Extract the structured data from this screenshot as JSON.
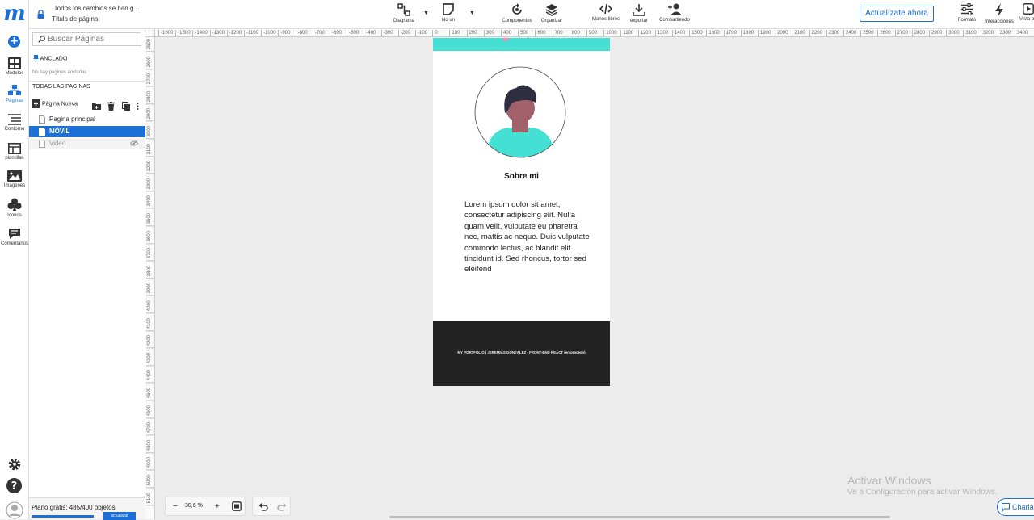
{
  "app": {
    "logo": "m"
  },
  "rail": {
    "items": [
      {
        "label": "Modelos",
        "icon": "templates-grid-icon"
      },
      {
        "label": "Páginas",
        "icon": "pages-icon"
      },
      {
        "label": "Contorno",
        "icon": "outline-icon"
      },
      {
        "label": "plantillas",
        "icon": "layout-icon"
      },
      {
        "label": "Imágenes",
        "icon": "image-icon"
      },
      {
        "label": "Iconos",
        "icon": "club-icon"
      },
      {
        "label": "Comentarios",
        "icon": "comment-icon"
      }
    ],
    "active_index": 1
  },
  "topbar": {
    "save_status": "¡Todos los cambios se han g...",
    "page_title": "Título de página",
    "tools": [
      {
        "label": "Diagrama"
      },
      {
        "label": "No un"
      },
      {
        "label": "Componentes"
      },
      {
        "label": "Organizar"
      },
      {
        "label": "Manos libres"
      },
      {
        "label": "exportar"
      },
      {
        "label": "Compartiendo"
      },
      {
        "label": "Formato"
      },
      {
        "label": "Interacciones"
      },
      {
        "label": "Vista p"
      }
    ],
    "upgrade_label": "Actualízate ahora"
  },
  "panel": {
    "search_placeholder": "Buscar Páginas",
    "pinned_header": "ANCLADO",
    "pinned_empty": "No hay páginas ancladas",
    "all_pages_header": "TODAS LAS PAGINAS",
    "new_page_label": "Página Nueva",
    "pages": [
      {
        "name": "Pagina principal",
        "state": "normal"
      },
      {
        "name": "MÓVIL",
        "state": "selected"
      },
      {
        "name": "Video",
        "state": "hidden"
      }
    ],
    "plan_text": "Plano gratis: 485/400 objetos",
    "plan_usage": 1.0,
    "plan_button": "actualizar"
  },
  "ruler": {
    "h_ticks": [
      "-1600",
      "-1500",
      "-1400",
      "-1300",
      "-1200",
      "-1100",
      "-1000",
      "-900",
      "-800",
      "-700",
      "-600",
      "-500",
      "-400",
      "-300",
      "-200",
      "-100",
      "0",
      "100",
      "200",
      "300",
      "400",
      "500",
      "600",
      "700",
      "800",
      "900",
      "1000",
      "1100",
      "1200",
      "1300",
      "1400",
      "1500",
      "1600",
      "1700",
      "1800",
      "1900",
      "2000",
      "2100",
      "2200",
      "2300",
      "2400",
      "2500",
      "2600",
      "2700",
      "2800",
      "2900",
      "3000",
      "3100",
      "3200",
      "3300",
      "3400"
    ],
    "v_ticks": [
      "2500",
      "2600",
      "2700",
      "2800",
      "2900",
      "3000",
      "3100",
      "3200",
      "3300",
      "3400",
      "3500",
      "3600",
      "3700",
      "3800",
      "3900",
      "4000",
      "4100",
      "4200",
      "4300",
      "4400",
      "4500",
      "4600",
      "4700",
      "4800",
      "4900",
      "5000",
      "5100"
    ]
  },
  "canvas": {
    "about_title": "Sobre mi",
    "about_text": "Lorem ipsum dolor sit amet, consectetur adipiscing elit. Nulla quam velit, vulputate eu pharetra nec, mattis ac neque. Duis vulputate commodo lectus, ac blandit elit tincidunt id. Sed rhoncus, tortor sed eleifend",
    "footer_text": "MY PORTFOLIO | JEREMIAS GONZALEZ - FRONT-END REACT (en proceso)",
    "colors": {
      "teal": "#44e0d4",
      "footer": "#222222",
      "skin": "#a0616a",
      "hair": "#2f2e41"
    }
  },
  "bottom": {
    "zoom_minus": "−",
    "zoom_value": "30,6 %",
    "zoom_plus": "+"
  },
  "watermark": {
    "line1": "Activar Windows",
    "line2": "Ve a Configuración para activar Windows."
  },
  "chat_label": "Charlar"
}
